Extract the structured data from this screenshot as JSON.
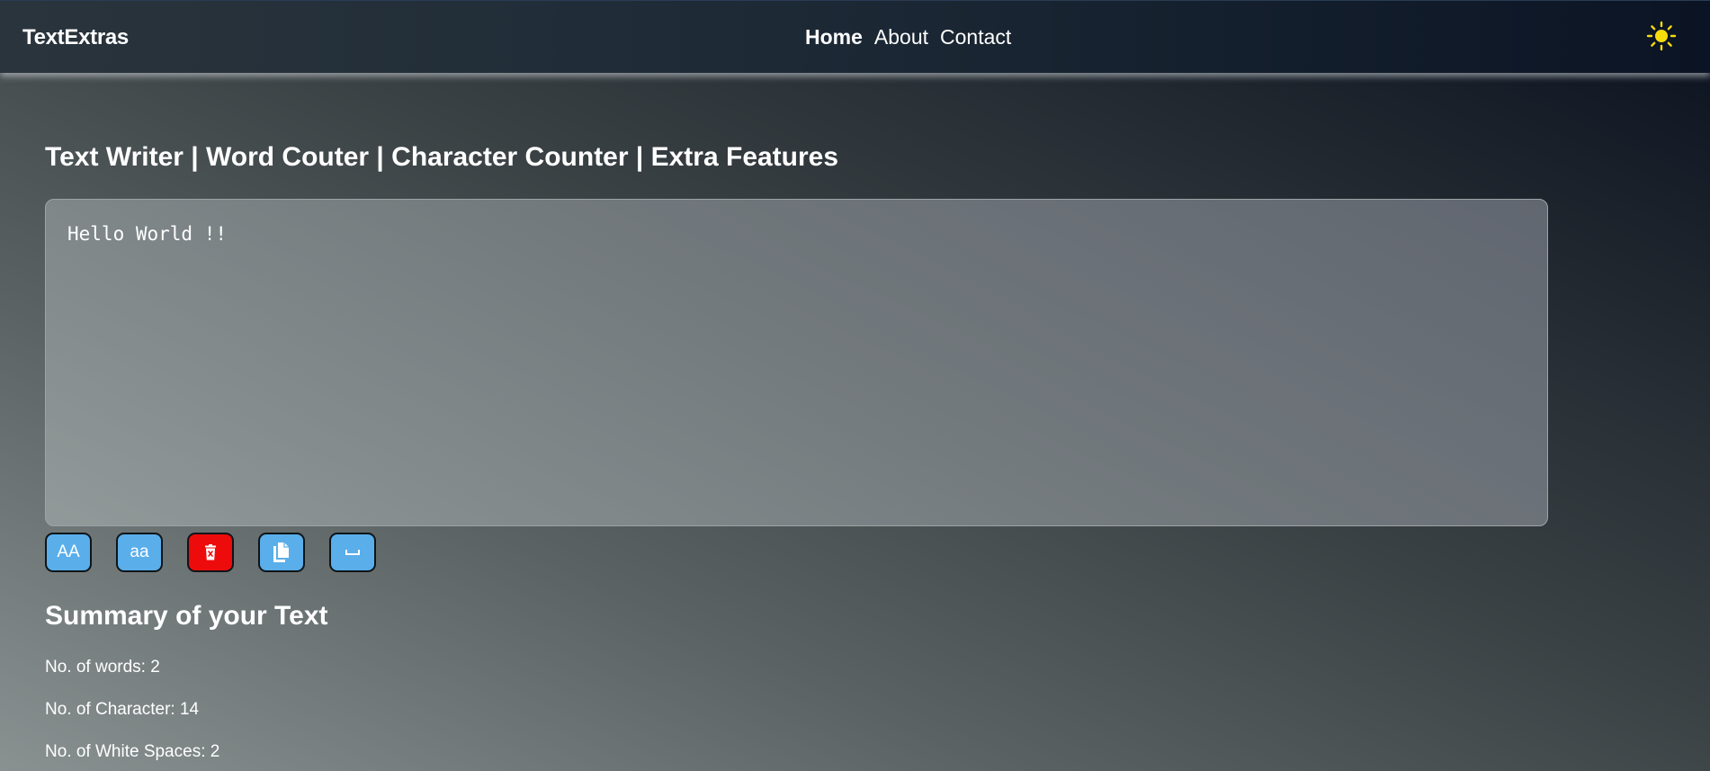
{
  "navbar": {
    "brand": "TextExtras",
    "links": [
      {
        "label": "Home",
        "active": true
      },
      {
        "label": "About",
        "active": false
      },
      {
        "label": "Contact",
        "active": false
      }
    ],
    "theme_toggle_icon": "sun-icon",
    "theme_toggle_color": "#f5dd0b"
  },
  "main": {
    "heading": "Text Writer | Word Couter | Character Counter | Extra Features",
    "textarea_value": "Hello World !!",
    "buttons": [
      {
        "label": "AA",
        "icon": "uppercase-icon",
        "color": "#5aaeea"
      },
      {
        "label": "aa",
        "icon": "lowercase-icon",
        "color": "#5aaeea"
      },
      {
        "label": "",
        "icon": "delete-icon",
        "color": "#ee0b0b"
      },
      {
        "label": "",
        "icon": "copy-icon",
        "color": "#5aaeea"
      },
      {
        "label": "",
        "icon": "space-bar-icon",
        "color": "#5aaeea"
      }
    ]
  },
  "summary": {
    "title": "Summary of your Text",
    "words": "No. of words: 2",
    "characters": "No. of Character: 14",
    "white_spaces": "No. of White Spaces: 2"
  }
}
